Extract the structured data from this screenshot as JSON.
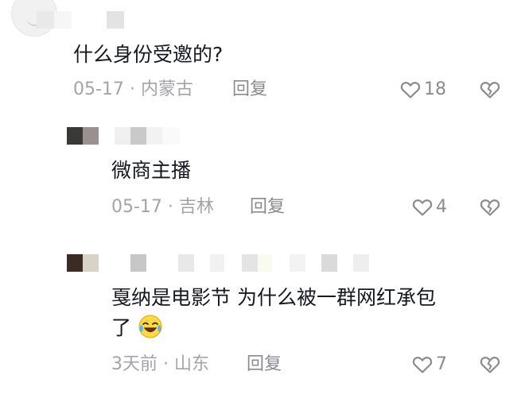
{
  "comments": [
    {
      "text": "什么身份受邀的?",
      "date": "05-17",
      "location": "内蒙古",
      "reply_label": "回复",
      "likes": "18"
    },
    {
      "text": "微商主播",
      "date": "05-17",
      "location": "吉林",
      "reply_label": "回复",
      "likes": "4"
    },
    {
      "text_line1": "戛纳是电影节 为什么被一群网红承包",
      "text_line2": "了",
      "date": "3天前",
      "location": "山东",
      "reply_label": "回复",
      "likes": "7",
      "emoji": "crying-laughing-face"
    }
  ],
  "separator": "·",
  "icons": {
    "like": "heart-outline-icon",
    "dislike": "broken-heart-icon"
  },
  "colors": {
    "text": "#161823",
    "meta": "#a3a4ab",
    "action": "#8a8b91"
  }
}
